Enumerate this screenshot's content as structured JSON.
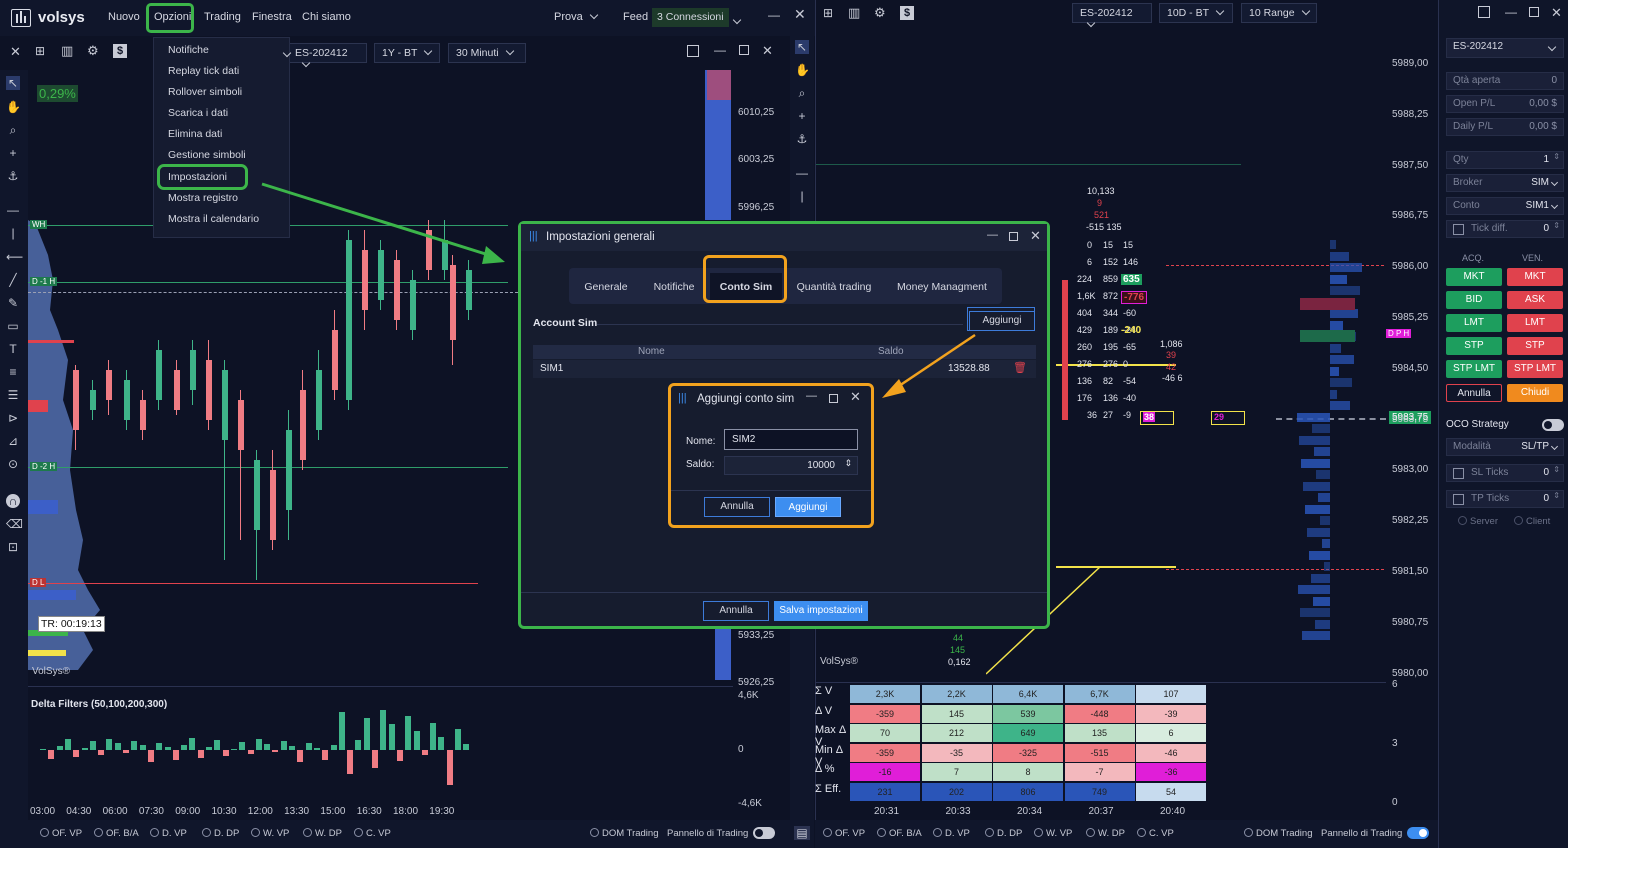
{
  "app": {
    "brand": "volsys"
  },
  "menubar": {
    "items": [
      "Nuovo",
      "Opzioni",
      "Trading",
      "Finestra",
      "Chi siamo"
    ],
    "prova": "Prova",
    "feed": "Feed",
    "connections": "3 Connessioni"
  },
  "opzioni_menu": [
    "Notifiche",
    "Replay tick dati",
    "Rollover simboli",
    "Scarica i dati",
    "Elimina dati",
    "Gestione simboli",
    "Impostazioni",
    "Mostra registro",
    "Mostra il calendario"
  ],
  "left_chart": {
    "symbol": "ES-202412",
    "period": "1Y - BT",
    "timeframe": "30 Minuti",
    "change": "0,29%",
    "timer": "TR: 00:19:13",
    "watermark": "VolSys®",
    "prices": [
      "6010,25",
      "6003,25",
      "5996,25",
      "5933,25",
      "5926,25"
    ],
    "level_labels": [
      "WH",
      "D -1 H",
      "D -2 H",
      "D L"
    ],
    "delta_title": "Delta Filters (50,100,200,300)",
    "delta_axis": [
      "4,6K",
      "0",
      "-4,6K"
    ],
    "times": [
      "03:00",
      "04:30",
      "06:00",
      "07:30",
      "09:00",
      "10:30",
      "12:00",
      "13:30",
      "15:00",
      "16:30",
      "18:00",
      "19:30"
    ]
  },
  "bottom_status_left": {
    "items": [
      "OF. VP",
      "OF. B/A",
      "D. VP",
      "D. DP",
      "W. VP",
      "W. DP",
      "C. VP"
    ],
    "dom": "DOM Trading",
    "panel": "Pannello di Trading"
  },
  "bottom_status_right": {
    "items": [
      "OF. VP",
      "OF. B/A",
      "D. VP",
      "D. DP",
      "W. VP",
      "W. DP",
      "C. VP"
    ],
    "dom": "DOM Trading",
    "panel": "Pannello di Trading"
  },
  "right_chart": {
    "symbol": "ES-202412",
    "period": "10D - BT",
    "range": "10 Range",
    "prices": [
      "5989,00",
      "5988,25",
      "5987,50",
      "5986,75",
      "5986,00",
      "5985,25",
      "5984,50",
      "5983,75",
      "5983,00",
      "5982,25",
      "5981,50",
      "5980,75",
      "5980,00"
    ],
    "current_price": "5983,75",
    "watermark": "VolSys®",
    "bottom_labels": [
      "44",
      "145",
      "0,162"
    ],
    "top_labels": [
      "10,133",
      "9",
      "521",
      "-515 135"
    ],
    "mid_labels": [
      "1,086",
      "39",
      "42",
      "-46 6"
    ],
    "dph": "D P H",
    "footprint_highlight": [
      "635",
      "-776",
      "-240",
      "38",
      "29"
    ],
    "stat_axis": [
      "6",
      "3",
      "0"
    ],
    "stat_labels": [
      "Σ V",
      "Δ V",
      "Max Δ V",
      "Min Δ V",
      "Δ %",
      "Σ Eff."
    ],
    "stat_rows": [
      [
        "2,3K",
        "2,2K",
        "6,4K",
        "6,7K",
        "107"
      ],
      [
        "-359",
        "145",
        "539",
        "-448",
        "-39"
      ],
      [
        "70",
        "212",
        "649",
        "135",
        "6"
      ],
      [
        "-359",
        "-35",
        "-325",
        "-515",
        "-46"
      ],
      [
        "-16",
        "7",
        "8",
        "-7",
        "-36"
      ],
      [
        "231",
        "202",
        "806",
        "749",
        "54"
      ]
    ],
    "stat_times": [
      "20:31",
      "20:33",
      "20:34",
      "20:37",
      "20:40"
    ]
  },
  "trade_panel": {
    "symbol": "ES-202412",
    "qta_aperta": "Qtà aperta",
    "qta_aperta_v": "0",
    "open_pl": "Open P/L",
    "open_pl_v": "0,00 $",
    "daily_pl": "Daily P/L",
    "daily_pl_v": "0,00 $",
    "qty": "Qty",
    "qty_v": "1",
    "broker": "Broker",
    "broker_v": "SIM",
    "conto": "Conto",
    "conto_v": "SIM1",
    "tick_diff": "Tick diff.",
    "tick_diff_v": "0",
    "acq": "ACQ.",
    "ven": "VEN.",
    "buy_buttons": [
      "MKT",
      "BID",
      "LMT",
      "STP",
      "STP LMT"
    ],
    "sell_buttons": [
      "MKT",
      "ASK",
      "LMT",
      "STP",
      "STP LMT"
    ],
    "annulla": "Annulla",
    "chiudi": "Chiudi",
    "oco": "OCO Strategy",
    "modalita": "Modalità",
    "modalita_v": "SL/TP",
    "sl_ticks": "SL Ticks",
    "sl_v": "0",
    "tp_ticks": "TP Ticks",
    "tp_v": "0",
    "server": "Server",
    "client": "Client"
  },
  "settings_dialog": {
    "title": "Impostazioni generali",
    "tabs": [
      "Generale",
      "Notifiche",
      "Conto Sim",
      "Quantità trading",
      "Money Managment"
    ],
    "account_label": "Account Sim",
    "add_button": "Aggiungi",
    "col_name": "Nome",
    "col_saldo": "Saldo",
    "rows": [
      {
        "name": "SIM1",
        "saldo": "13528.88"
      }
    ],
    "cancel": "Annulla",
    "save": "Salva impostazioni"
  },
  "add_dialog": {
    "title": "Aggiungi conto sim",
    "name_label": "Nome:",
    "name_value": "SIM2",
    "saldo_label": "Saldo:",
    "saldo_value": "10000",
    "cancel": "Annulla",
    "add": "Aggiungi"
  }
}
